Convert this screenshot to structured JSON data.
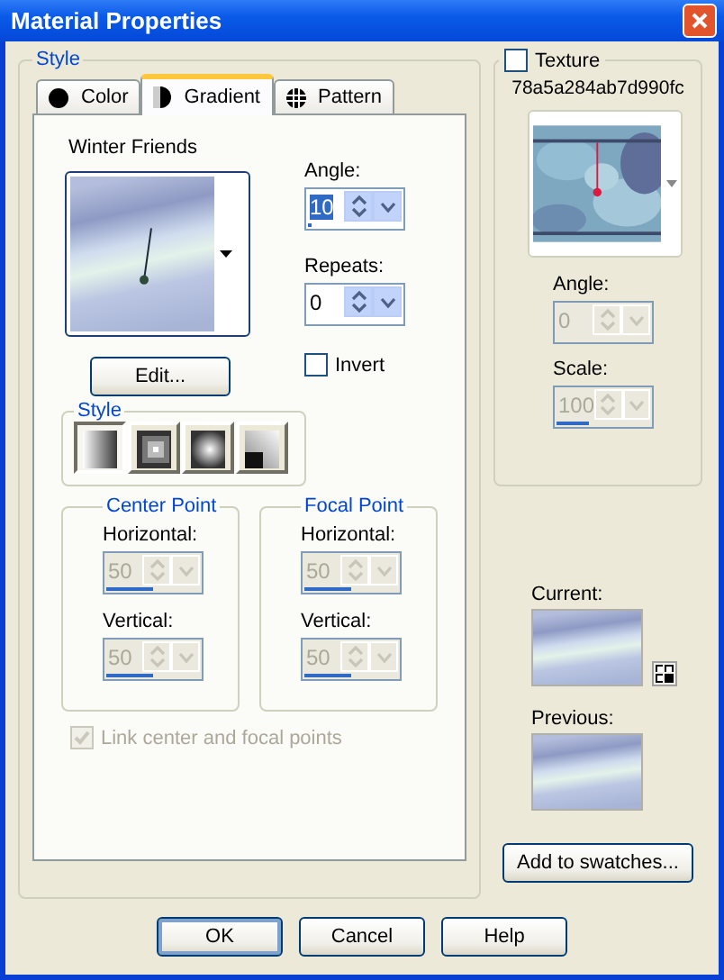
{
  "window": {
    "title": "Material Properties"
  },
  "style": {
    "title": "Style",
    "tabs": [
      {
        "label": "Color",
        "kind": "circle",
        "selected": false
      },
      {
        "label": "Gradient",
        "kind": "half",
        "selected": true
      },
      {
        "label": "Pattern",
        "kind": "pattern",
        "selected": false
      }
    ],
    "gradient_name": "Winter Friends",
    "angle": {
      "label": "Angle:",
      "value": "10",
      "level": 0.03,
      "disabled": false,
      "text_selected": true
    },
    "repeats": {
      "label": "Repeats:",
      "value": "0",
      "level": 0,
      "disabled": false,
      "text_selected": false
    },
    "edit_button": "Edit...",
    "invert": {
      "label": "Invert",
      "checked": false,
      "disabled": false
    },
    "style_group": {
      "title": "Style",
      "buttons": [
        {
          "kind": "linear",
          "selected": true
        },
        {
          "kind": "rectangular",
          "selected": false
        },
        {
          "kind": "sunburst",
          "selected": false
        },
        {
          "kind": "radial",
          "selected": false
        }
      ]
    },
    "points": [
      {
        "title": "Center Point",
        "fields": [
          {
            "label": "Horizontal:",
            "value": "50",
            "level": 0.5,
            "disabled": true,
            "text_selected": false
          },
          {
            "label": "Vertical:",
            "value": "50",
            "level": 0.5,
            "disabled": true,
            "text_selected": false
          }
        ]
      },
      {
        "title": "Focal Point",
        "fields": [
          {
            "label": "Horizontal:",
            "value": "50",
            "level": 0.5,
            "disabled": true,
            "text_selected": false
          },
          {
            "label": "Vertical:",
            "value": "50",
            "level": 0.5,
            "disabled": true,
            "text_selected": false
          }
        ]
      }
    ],
    "link": {
      "label": "Link center and focal points",
      "checked": true,
      "disabled": true
    }
  },
  "texture": {
    "label": "Texture",
    "checked": false,
    "name": "78a5a284ab7d990fc",
    "angle": {
      "label": "Angle:",
      "value": "0",
      "level": 0,
      "disabled": true,
      "text_selected": false
    },
    "scale": {
      "label": "Scale:",
      "value": "100",
      "level": 0.35,
      "disabled": true,
      "text_selected": false
    }
  },
  "current": {
    "label": "Current:"
  },
  "previous": {
    "label": "Previous:"
  },
  "add_button": "Add to swatches...",
  "buttons": [
    {
      "label": "OK",
      "default": true
    },
    {
      "label": "Cancel",
      "default": false
    },
    {
      "label": "Help",
      "default": false
    }
  ]
}
